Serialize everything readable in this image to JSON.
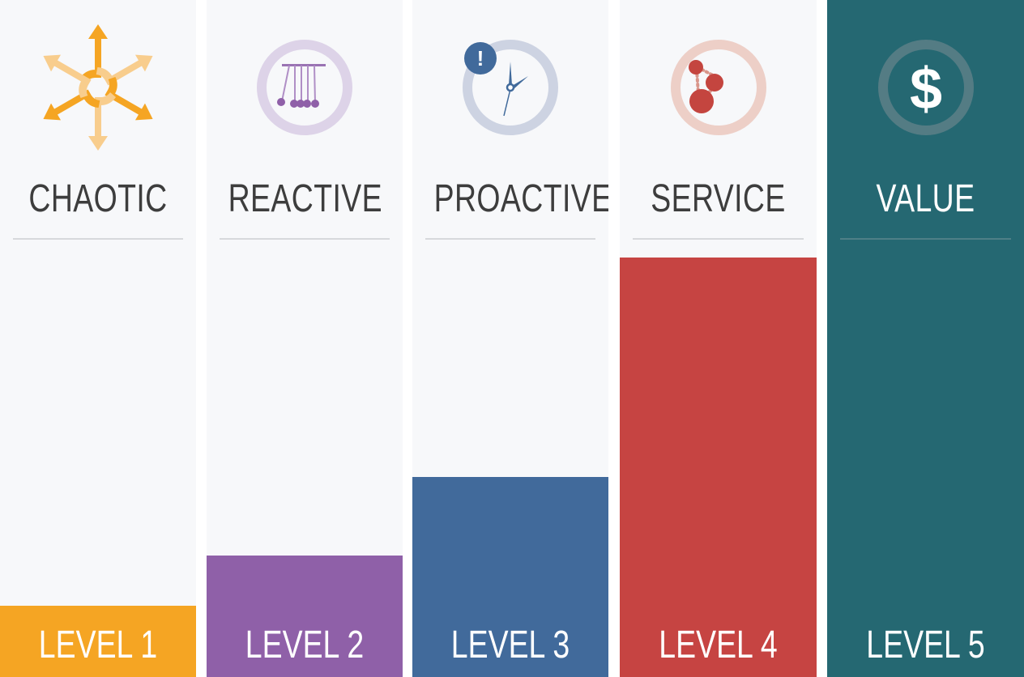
{
  "levels": [
    {
      "title": "CHAOTIC",
      "label": "LEVEL 1",
      "icon": "chaos-arrows-icon",
      "color": "#f5a523",
      "fill_percent": 10.5
    },
    {
      "title": "REACTIVE",
      "label": "LEVEL 2",
      "icon": "newtons-cradle-icon",
      "color": "#8f60a8",
      "fill_percent": 18
    },
    {
      "title": "PROACTIVE",
      "label": "LEVEL 3",
      "icon": "clock-alert-icon",
      "color": "#416a9b",
      "fill_percent": 29.5
    },
    {
      "title": "SERVICE",
      "label": "LEVEL 4",
      "icon": "network-nodes-icon",
      "color": "#c64442",
      "fill_percent": 62
    },
    {
      "title": "VALUE",
      "label": "LEVEL 5",
      "icon": "dollar-icon",
      "color": "#256872",
      "fill_percent": 100
    }
  ],
  "badge": "!",
  "dollar": "$"
}
